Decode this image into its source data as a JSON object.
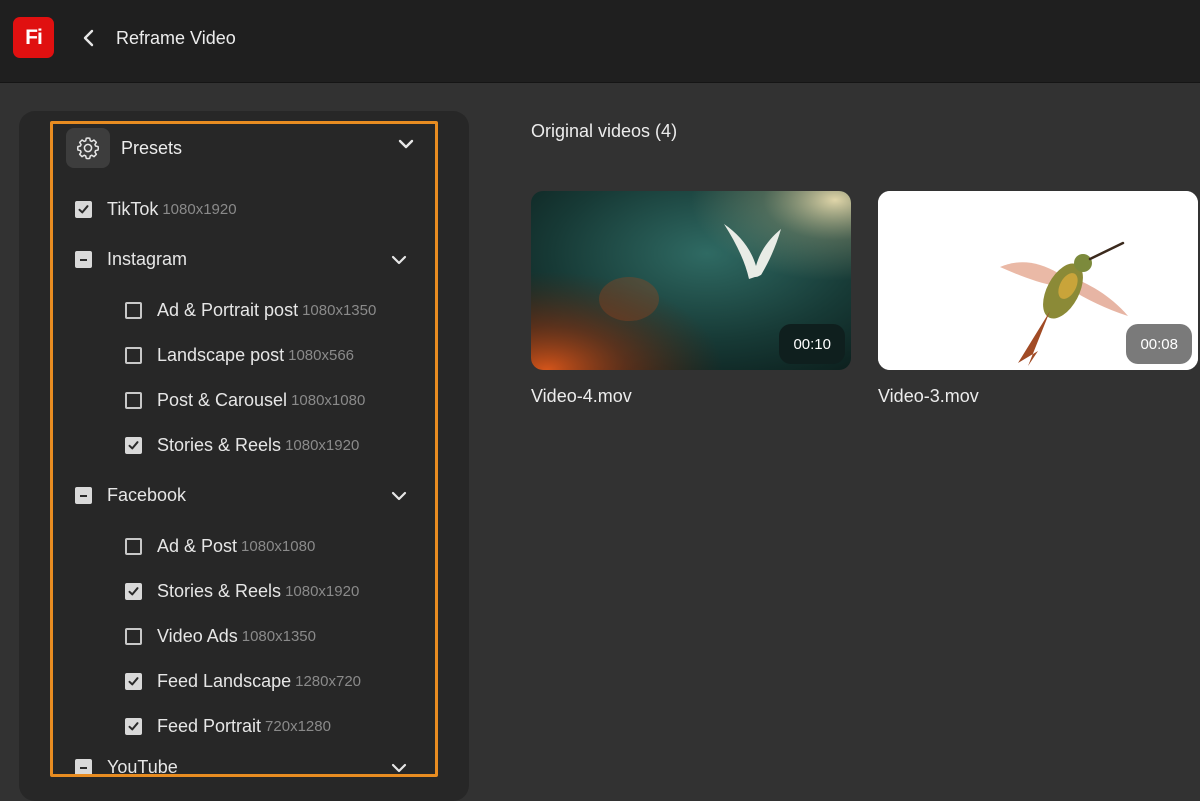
{
  "app": {
    "logo_text": "Fi",
    "title": "Reframe Video",
    "logo_color": "#e01010"
  },
  "presets": {
    "title": "Presets",
    "icon": "gear-icon",
    "accent": "#e88c21",
    "groups": [
      {
        "label": "TikTok",
        "dim": "1080x1920",
        "state": "checked",
        "items": []
      },
      {
        "label": "Instagram",
        "dim": "",
        "state": "mixed",
        "items": [
          {
            "label": "Ad & Portrait post",
            "dim": "1080x1350",
            "checked": false
          },
          {
            "label": "Landscape post",
            "dim": "1080x566",
            "checked": false
          },
          {
            "label": "Post & Carousel",
            "dim": "1080x1080",
            "checked": false
          },
          {
            "label": "Stories & Reels",
            "dim": "1080x1920",
            "checked": true
          }
        ]
      },
      {
        "label": "Facebook",
        "dim": "",
        "state": "mixed",
        "items": [
          {
            "label": "Ad & Post",
            "dim": "1080x1080",
            "checked": false
          },
          {
            "label": "Stories & Reels",
            "dim": "1080x1920",
            "checked": true
          },
          {
            "label": "Video Ads",
            "dim": "1080x1350",
            "checked": false
          },
          {
            "label": "Feed Landscape",
            "dim": "1280x720",
            "checked": true
          },
          {
            "label": "Feed Portrait",
            "dim": "720x1280",
            "checked": true
          }
        ]
      },
      {
        "label": "YouTube",
        "dim": "",
        "state": "mixed",
        "items": []
      }
    ]
  },
  "videos": {
    "title": "Original videos (4)",
    "items": [
      {
        "name": "Video-4.mov",
        "duration": "00:10",
        "thumbnail": "dove-image"
      },
      {
        "name": "Video-3.mov",
        "duration": "00:08",
        "thumbnail": "hummingbird-image"
      }
    ]
  }
}
